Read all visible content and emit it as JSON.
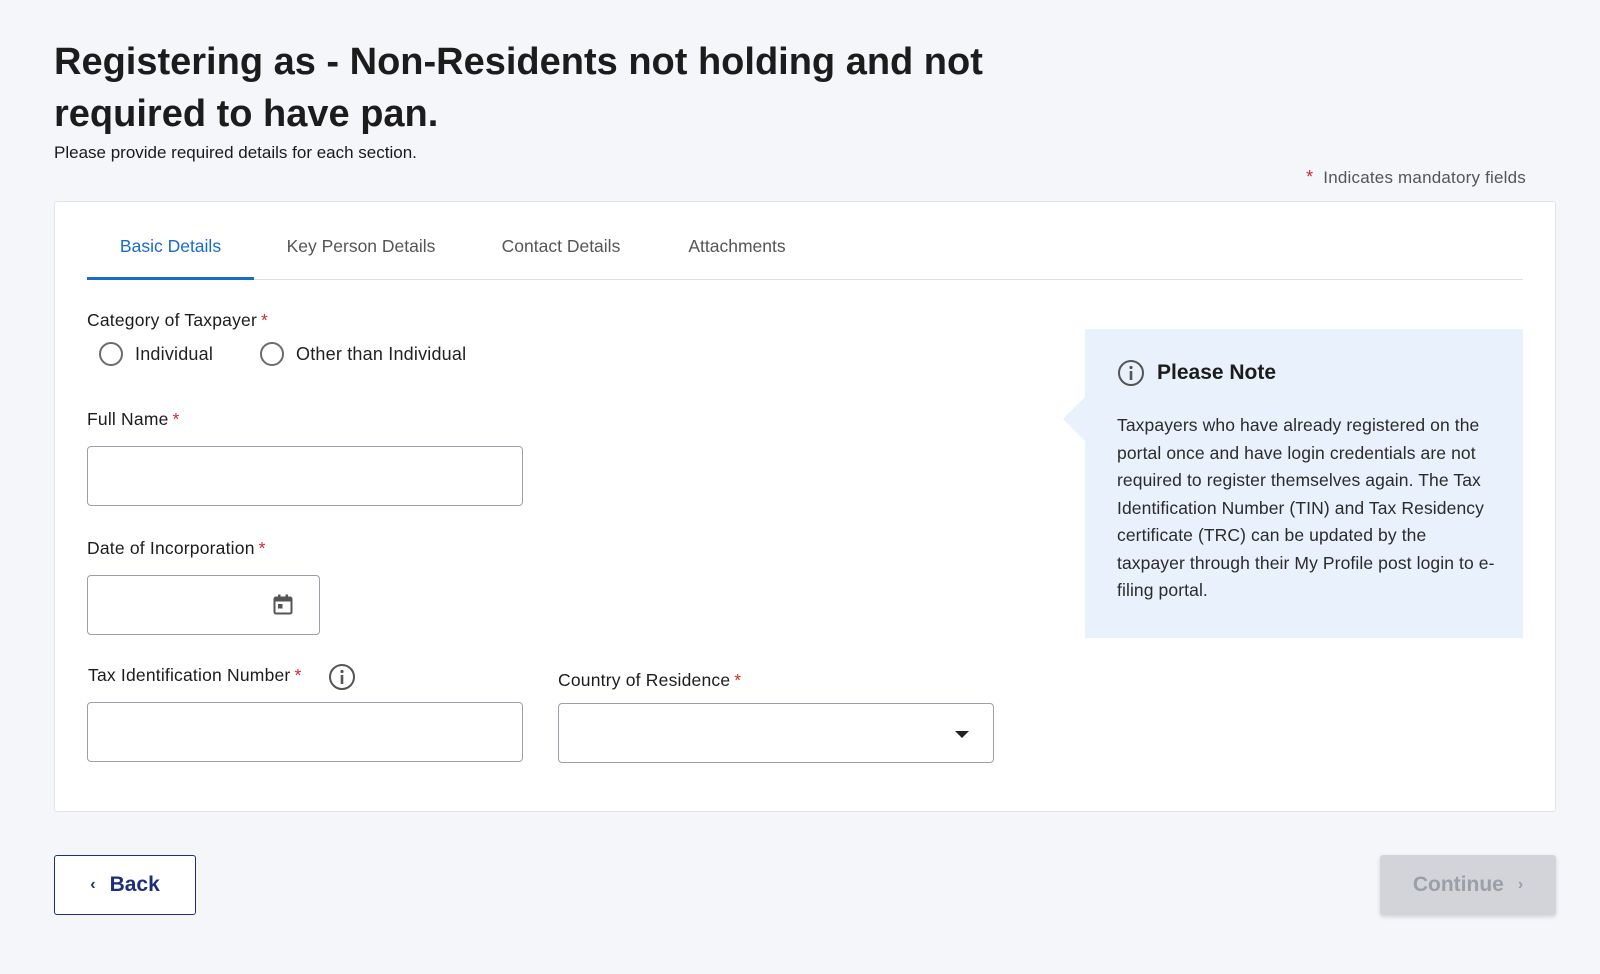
{
  "header": {
    "title": "Registering as -  Non-Residents not holding and not required to have pan.",
    "subtitle": "Please provide required details for each section.",
    "mandatory_star": "*",
    "mandatory_text": "Indicates mandatory fields"
  },
  "tabs": [
    {
      "label": "Basic Details",
      "active": true
    },
    {
      "label": "Key Person Details",
      "active": false
    },
    {
      "label": "Contact Details",
      "active": false
    },
    {
      "label": "Attachments",
      "active": false
    }
  ],
  "form": {
    "required_star": "*",
    "category": {
      "label": "Category of Taxpayer",
      "options": [
        "Individual",
        "Other than Individual"
      ],
      "selected": null
    },
    "full_name": {
      "label": "Full Name",
      "value": ""
    },
    "date_of_incorporation": {
      "label": "Date of Incorporation",
      "value": "",
      "icon": "calendar-icon"
    },
    "tin": {
      "label": "Tax Identification Number",
      "value": "",
      "icon": "info-icon"
    },
    "country": {
      "label": "Country of Residence",
      "value": "",
      "icon": "caret-down-icon"
    }
  },
  "note": {
    "icon": "info-icon",
    "title": "Please Note",
    "text": "Taxpayers who have already registered on the portal once and have login credentials are not required to register themselves again. The Tax Identification Number (TIN) and Tax Residency certificate (TRC) can be updated by the taxpayer through their My Profile post login to e-filing portal."
  },
  "actions": {
    "back_label": "Back",
    "back_icon": "chevron-left-icon",
    "continue_label": "Continue",
    "continue_icon": "chevron-right-icon",
    "continue_enabled": false
  },
  "colors": {
    "accent": "#1a6bc9",
    "required": "#d12a2a",
    "primary_dark": "#1d2e7a",
    "note_background": "#e8f1fc"
  }
}
